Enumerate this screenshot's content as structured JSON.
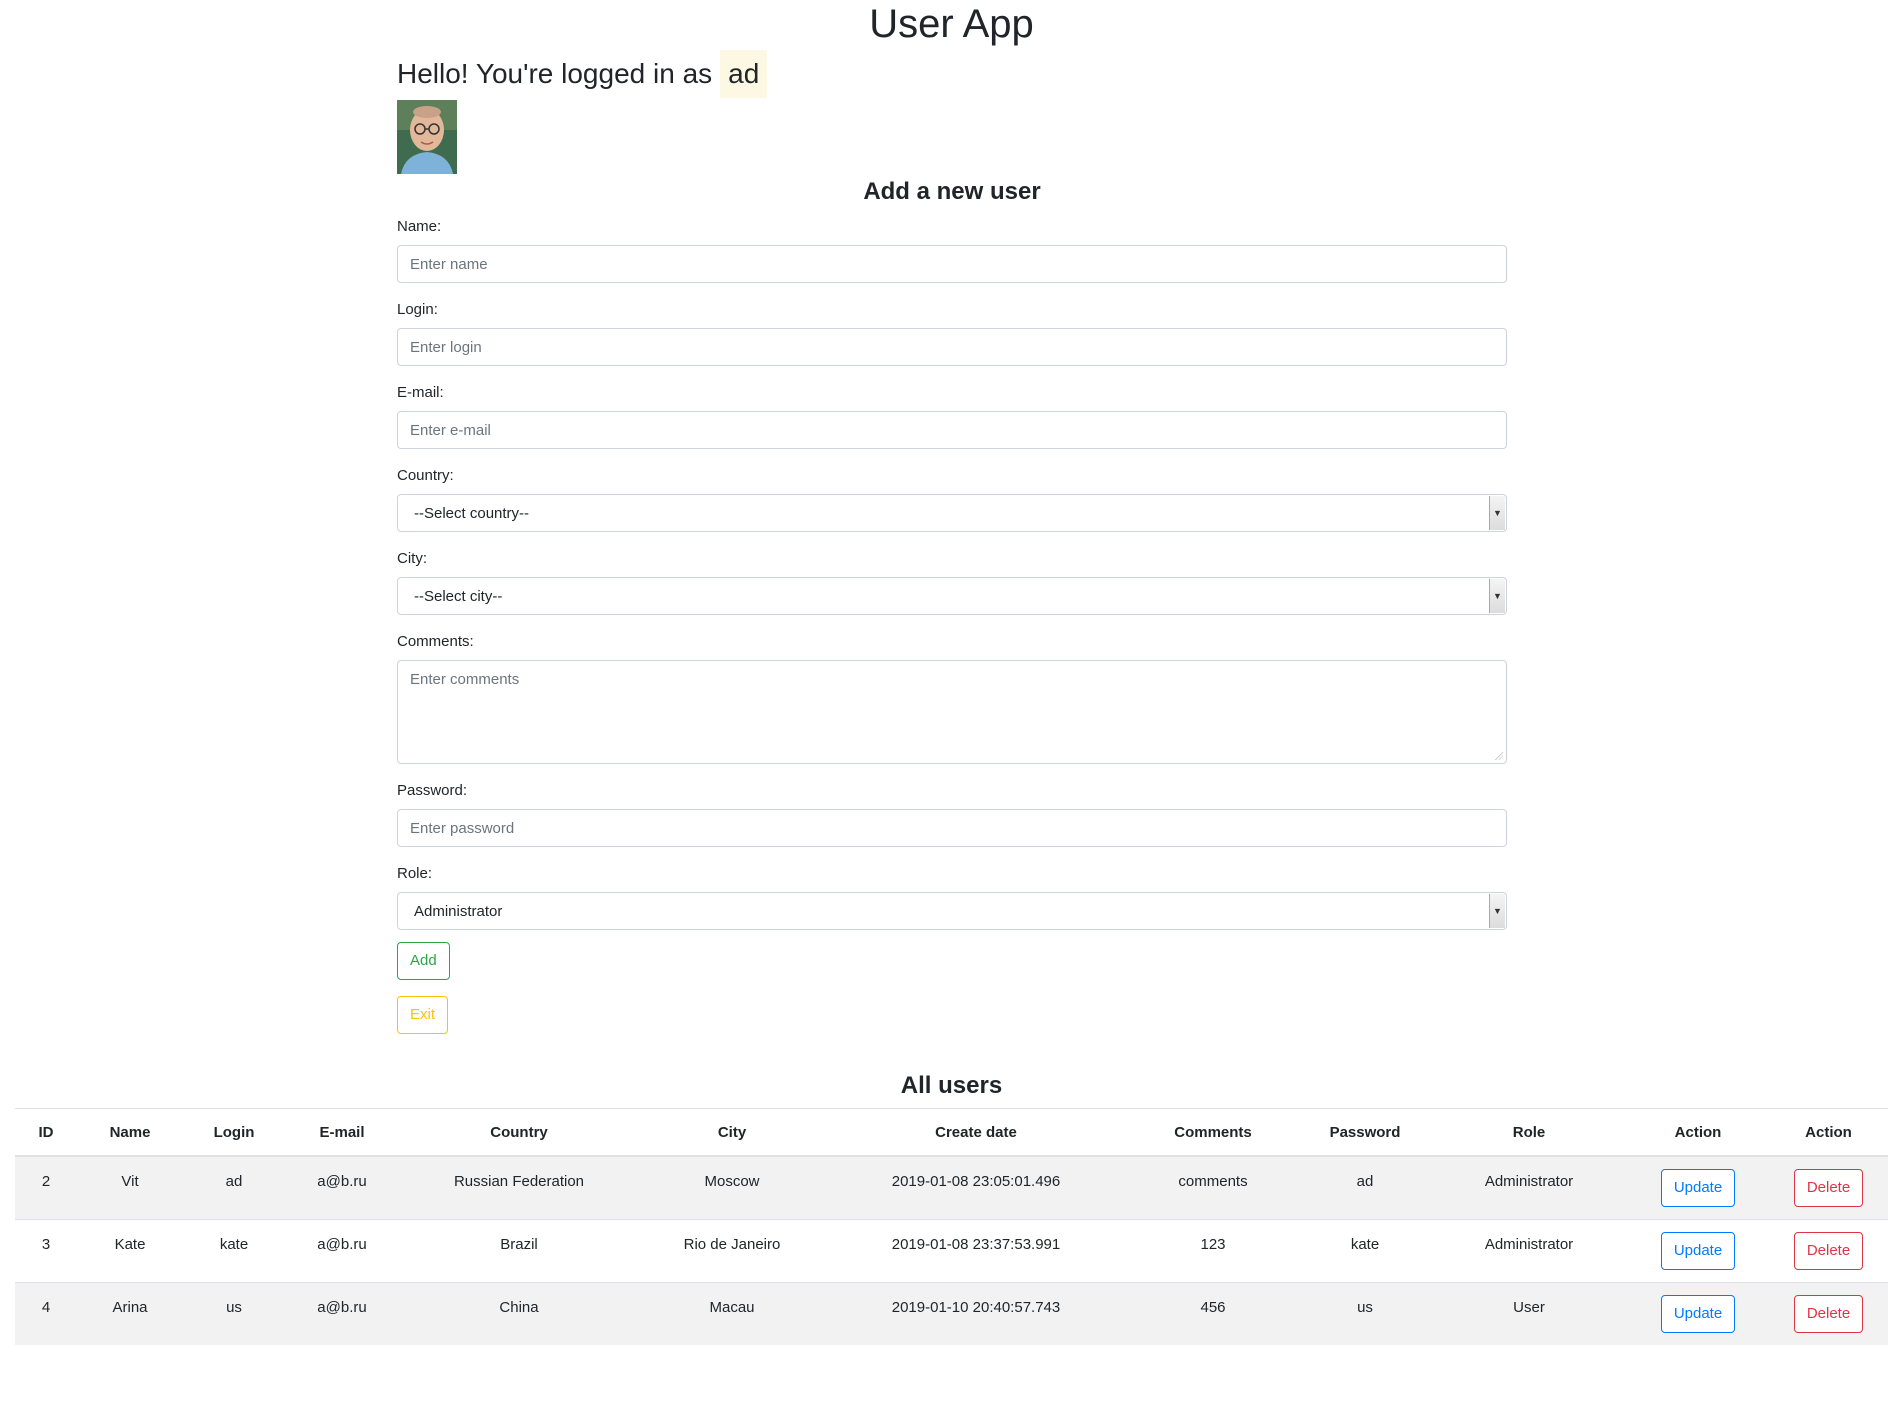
{
  "app": {
    "title": "User App"
  },
  "greeting": {
    "prefix": "Hello! You're logged in as",
    "user": "ad"
  },
  "form": {
    "title": "Add a new user",
    "name": {
      "label": "Name:",
      "placeholder": "Enter name"
    },
    "login": {
      "label": "Login:",
      "placeholder": "Enter login"
    },
    "email": {
      "label": "E-mail:",
      "placeholder": "Enter e-mail"
    },
    "country": {
      "label": "Country:",
      "selected": "--Select country--"
    },
    "city": {
      "label": "City:",
      "selected": "--Select city--"
    },
    "comments": {
      "label": "Comments:",
      "placeholder": "Enter comments"
    },
    "password": {
      "label": "Password:",
      "placeholder": "Enter password"
    },
    "role": {
      "label": "Role:",
      "selected": "Administrator"
    },
    "add_label": "Add",
    "exit_label": "Exit"
  },
  "users": {
    "title": "All users",
    "columns": [
      "ID",
      "Name",
      "Login",
      "E-mail",
      "Country",
      "City",
      "Create date",
      "Comments",
      "Password",
      "Role",
      "Action",
      "Action"
    ],
    "rows": [
      {
        "id": "2",
        "name": "Vit",
        "login": "ad",
        "email": "a@b.ru",
        "country": "Russian Federation",
        "city": "Moscow",
        "created": "2019-01-08 23:05:01.496",
        "comments": "comments",
        "password": "ad",
        "role": "Administrator",
        "update": "Update",
        "delete": "Delete"
      },
      {
        "id": "3",
        "name": "Kate",
        "login": "kate",
        "email": "a@b.ru",
        "country": "Brazil",
        "city": "Rio de Janeiro",
        "created": "2019-01-08 23:37:53.991",
        "comments": "123",
        "password": "kate",
        "role": "Administrator",
        "update": "Update",
        "delete": "Delete"
      },
      {
        "id": "4",
        "name": "Arina",
        "login": "us",
        "email": "a@b.ru",
        "country": "China",
        "city": "Macau",
        "created": "2019-01-10 20:40:57.743",
        "comments": "456",
        "password": "us",
        "role": "User",
        "update": "Update",
        "delete": "Delete"
      }
    ]
  },
  "colors": {
    "add": "#28a745",
    "exit": "#ffc107",
    "update": "#007bff",
    "delete": "#dc3545",
    "user_highlight": "#fcf8e3"
  }
}
